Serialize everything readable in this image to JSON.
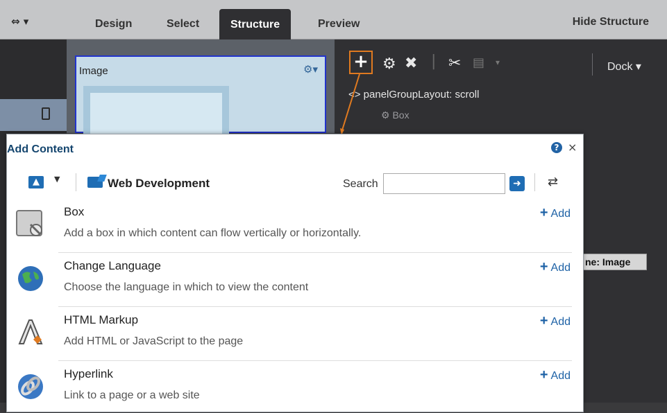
{
  "topbar": {
    "logo": "∞",
    "tabs": [
      "Design",
      "Select",
      "Structure",
      "Preview"
    ],
    "hide_structure": "Hide Structure"
  },
  "canvas": {
    "image_label": "Image"
  },
  "structure": {
    "dock_label": "Dock",
    "tree": [
      "<> panelGroupLayout: scroll",
      "Box"
    ],
    "name_chip": "ne: Image"
  },
  "dialog": {
    "title": "Add Content",
    "breadcrumb": "Web Development",
    "search_label": "Search",
    "search_value": "",
    "add_label": "Add",
    "items": [
      {
        "name": "Box",
        "desc": "Add a box in which content can flow vertically or horizontally."
      },
      {
        "name": "Change Language",
        "desc": "Choose the language in which to view the content"
      },
      {
        "name": "HTML Markup",
        "desc": "Add HTML or JavaScript to the page"
      },
      {
        "name": "Hyperlink",
        "desc": "Link to a page or a web site"
      }
    ]
  },
  "colors": {
    "accent_blue": "#1e62a6",
    "highlight_orange": "#e07a20",
    "selection_blue": "#2233cc"
  }
}
